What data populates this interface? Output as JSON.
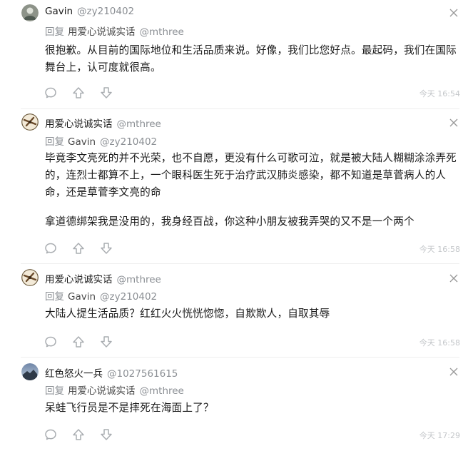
{
  "comments": [
    {
      "username": "Gavin",
      "handle": "@zy210402",
      "reply_prefix": "回复",
      "reply_to_name": "用爱心说诚实话",
      "reply_to_handle": "@mthree",
      "paragraphs": [
        "很抱歉。从目前的国际地位和生活品质来说。好像，我们比您好点。最起码，我们在国际舞台上，认可度就很高。"
      ],
      "time": "今天 16:54"
    },
    {
      "username": "用爱心说诚实话",
      "handle": "@mthree",
      "reply_prefix": "回复",
      "reply_to_name": "Gavin",
      "reply_to_handle": "@zy210402",
      "paragraphs": [
        "毕竟李文亮死的并不光荣，也不自愿，更没有什么可歌可泣，就是被大陆人糊糊涂涂弄死的，连烈士都算不上，一个眼科医生死于治疗武汉肺炎感染，都不知道是草菅病人的人命，还是草菅李文亮的命",
        "拿道德绑架我是没用的，我身经百战，你这种小朋友被我弄哭的又不是一个两个"
      ],
      "time": "今天 16:58"
    },
    {
      "username": "用爱心说诚实话",
      "handle": "@mthree",
      "reply_prefix": "回复",
      "reply_to_name": "Gavin",
      "reply_to_handle": "@zy210402",
      "paragraphs": [
        "大陆人提生活品质？红红火火恍恍惚惚，自欺欺人，自取其辱"
      ],
      "time": "今天 16:58"
    },
    {
      "username": "红色怒火一兵",
      "handle": "@1027561615",
      "reply_prefix": "回复",
      "reply_to_name": "用爱心说诚实话",
      "reply_to_handle": "@mthree",
      "paragraphs": [
        "呆蛙飞行员是不是摔死在海面上了？"
      ],
      "time": "今天 17:29"
    }
  ],
  "icons": {
    "comment": "comment-icon",
    "upvote": "upvote-arrow-icon",
    "downvote": "downvote-arrow-icon",
    "more": "more-options-icon"
  }
}
